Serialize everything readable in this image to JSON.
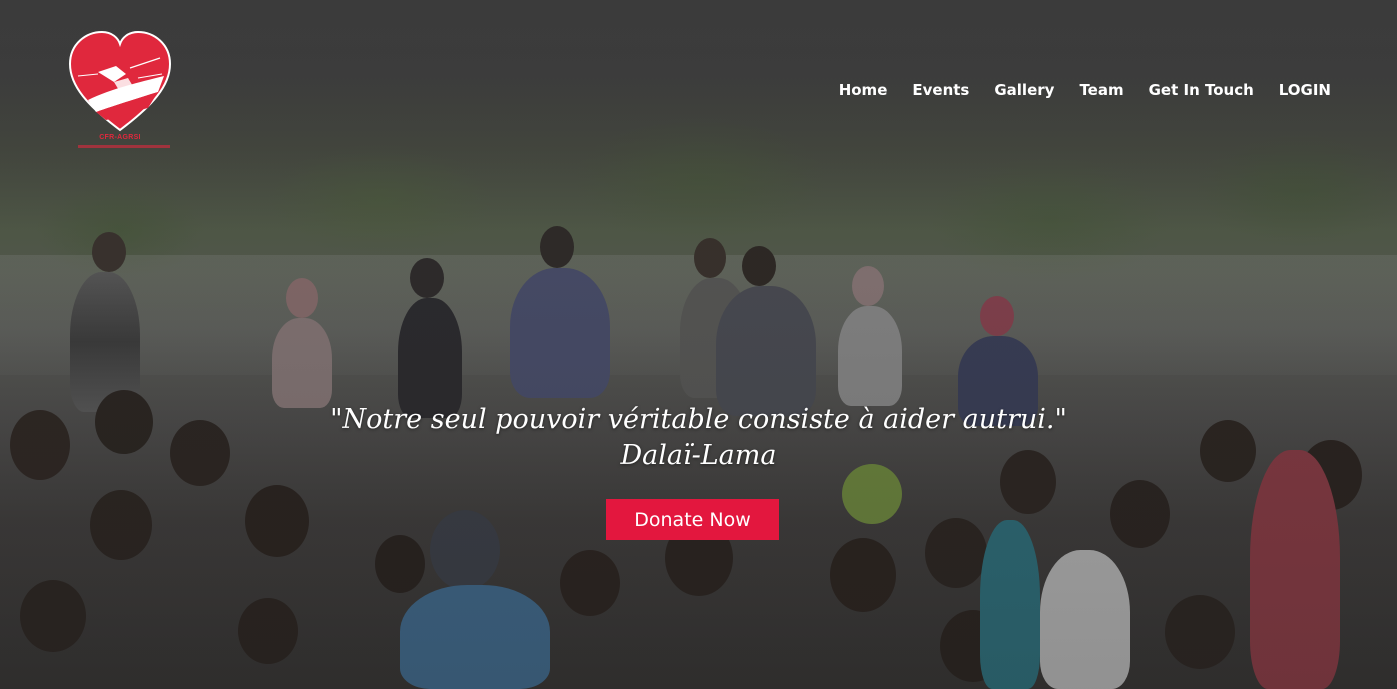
{
  "brand": {
    "logo_text": "CFR-AGRSI",
    "colors": {
      "primary": "#e3173e",
      "logo_red": "#e0283d"
    }
  },
  "nav": {
    "items": [
      {
        "label": "Home"
      },
      {
        "label": "Events"
      },
      {
        "label": "Gallery"
      },
      {
        "label": "Team"
      },
      {
        "label": "Get In Touch"
      },
      {
        "label": "LOGIN"
      }
    ]
  },
  "hero": {
    "quote": "\"Notre seul pouvoir véritable consiste à aider autrui.\"",
    "author": "Dalaï-Lama",
    "cta_label": "Donate Now"
  }
}
